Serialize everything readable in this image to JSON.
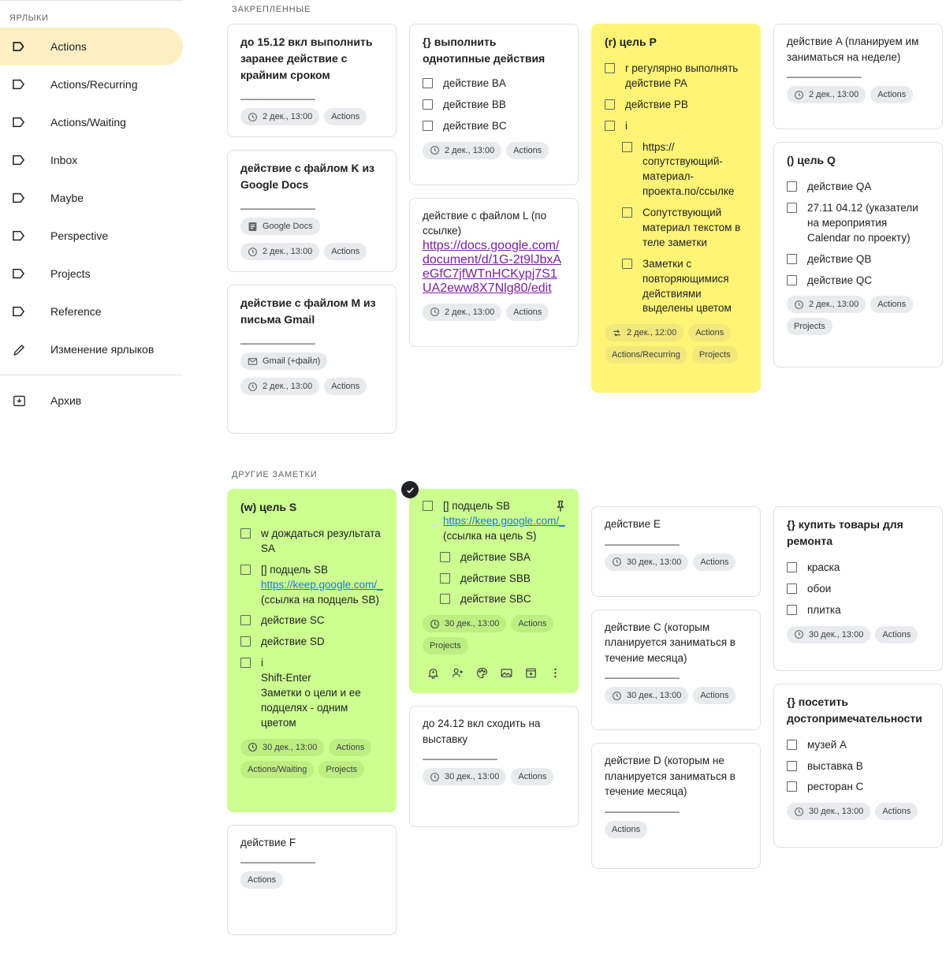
{
  "sidebar": {
    "header": "ЯРЛЫКИ",
    "items": [
      {
        "label": "Actions",
        "icon": "label-icon",
        "active": true
      },
      {
        "label": "Actions/Recurring",
        "icon": "label-icon",
        "active": false
      },
      {
        "label": "Actions/Waiting",
        "icon": "label-icon",
        "active": false
      },
      {
        "label": "Inbox",
        "icon": "label-icon",
        "active": false
      },
      {
        "label": "Maybe",
        "icon": "label-icon",
        "active": false
      },
      {
        "label": "Perspective",
        "icon": "label-icon",
        "active": false
      },
      {
        "label": "Projects",
        "icon": "label-icon",
        "active": false
      },
      {
        "label": "Reference",
        "icon": "label-icon",
        "active": false
      },
      {
        "label": "Изменение ярлыков",
        "icon": "pencil-icon",
        "active": false
      }
    ],
    "archive": {
      "label": "Архив",
      "icon": "archive-icon"
    }
  },
  "colors": {
    "yellow_note": "#fff475",
    "green_note": "#ccff90",
    "active_nav": "#feefc3",
    "chip_bg": "#e8eaed",
    "link_purple": "#7b1fa2",
    "link_blue": "#1a73e8"
  },
  "sections": {
    "pinned_title": "ЗАКРЕПЛЕННЫЕ",
    "other_title": "ДРУГИЕ ЗАМЕТКИ"
  },
  "notes": {
    "n1": {
      "title": "до 15.12 вкл выполнить заранее действие с крайним сроком",
      "dash": "______________",
      "chips": [
        {
          "label": "2 дек., 13:00",
          "icon": "clock-icon"
        },
        {
          "label": "Actions",
          "icon": "none"
        }
      ]
    },
    "n2": {
      "title": "действие с файлом K из Google Docs",
      "dash": "______________",
      "chips": [
        {
          "label": "Google Docs",
          "icon": "gdocs-icon"
        },
        {
          "label": "2 дек., 13:00",
          "icon": "clock-icon"
        },
        {
          "label": "Actions",
          "icon": "none"
        }
      ]
    },
    "n3": {
      "title": "действие с файлом M из письма Gmail",
      "dash": "______________",
      "chips": [
        {
          "label": "Gmail (+файл)",
          "icon": "gmail-icon"
        },
        {
          "label": "2 дек., 13:00",
          "icon": "clock-icon"
        },
        {
          "label": "Actions",
          "icon": "none"
        }
      ]
    },
    "n4": {
      "title": "{} выполнить однотипные действия",
      "items": [
        {
          "text": "действие BA",
          "indent": false
        },
        {
          "text": "действие BB",
          "indent": false
        },
        {
          "text": "действие BC",
          "indent": false
        }
      ],
      "chips": [
        {
          "label": "2 дек., 13:00",
          "icon": "clock-icon"
        },
        {
          "label": "Actions",
          "icon": "none"
        }
      ]
    },
    "n5": {
      "title": "действие с файлом L (по ссылке)",
      "link": "https://docs.google.com/document/d/1G-2t9lJbxAeGfC7jfWTnHCKypj7S1UA2eww8X7Nlg80/edit",
      "chips": [
        {
          "label": "2 дек., 13:00",
          "icon": "clock-icon"
        },
        {
          "label": "Actions",
          "icon": "none"
        }
      ]
    },
    "n6": {
      "title": "(r) цель P",
      "items": [
        {
          "text": "r регулярно выполнять действие PA",
          "indent": false
        },
        {
          "text": "действие PB",
          "indent": false
        },
        {
          "text": "i",
          "indent": false
        },
        {
          "text": "https://сопутствующий-материал-проекта.по/ссылке",
          "indent": true
        },
        {
          "text": "Сопутствующий материал текстом в теле заметки",
          "indent": true
        },
        {
          "text": "Заметки с повторяющимися действиями выделены цветом",
          "indent": true
        }
      ],
      "chips": [
        {
          "label": "2 дек., 12:00",
          "icon": "repeat-icon"
        },
        {
          "label": "Actions",
          "icon": "none"
        },
        {
          "label": "Actions/Recurring",
          "icon": "none"
        },
        {
          "label": "Projects",
          "icon": "none"
        }
      ]
    },
    "n7": {
      "title": "действие A (планируем им заниматься на неделе)",
      "dash": "______________",
      "chips": [
        {
          "label": "2 дек., 13:00",
          "icon": "clock-icon"
        },
        {
          "label": "Actions",
          "icon": "none"
        }
      ]
    },
    "n8": {
      "title": "() цель Q",
      "items": [
        {
          "text": "действие QA",
          "indent": false
        },
        {
          "text": "27.11 04.12 (указатели на мероприятия Calendar по проекту)",
          "indent": false
        },
        {
          "text": "действие QB",
          "indent": false
        },
        {
          "text": "действие QC",
          "indent": false
        }
      ],
      "chips": [
        {
          "label": "2 дек., 13:00",
          "icon": "clock-icon"
        },
        {
          "label": "Actions",
          "icon": "none"
        },
        {
          "label": "Projects",
          "icon": "none"
        }
      ]
    },
    "n9": {
      "title": "(w) цель S",
      "items": [
        {
          "text": "w дождаться результата SA",
          "indent": false
        },
        {
          "text": "[] подцель SB",
          "indent": false,
          "link": "https://keep.google.com/_",
          "after": "(ссылка на подцель SB)"
        },
        {
          "text": "действие SC",
          "indent": false
        },
        {
          "text": "действие SD",
          "indent": false
        },
        {
          "text": "i",
          "indent": false,
          "extra": "Shift-Enter\nЗаметки о цели и ее подцелях - одним цветом"
        }
      ],
      "chips": [
        {
          "label": "30 дек., 13:00",
          "icon": "clock-icon"
        },
        {
          "label": "Actions",
          "icon": "none"
        },
        {
          "label": "Actions/Waiting",
          "icon": "none"
        },
        {
          "label": "Projects",
          "icon": "none"
        }
      ]
    },
    "n10": {
      "title": "действие F",
      "dash": "______________",
      "chips": [
        {
          "label": "Actions",
          "icon": "none"
        }
      ]
    },
    "n11": {
      "first_item": "[] подцель SB",
      "link": "https://keep.google.com/_",
      "after_link": " (ссылка на цель S)",
      "items": [
        {
          "text": "действие SBA",
          "indent": true
        },
        {
          "text": "действие SBB",
          "indent": true
        },
        {
          "text": "действие SBC",
          "indent": true
        }
      ],
      "chips": [
        {
          "label": "30 дек., 13:00",
          "icon": "clock-icon"
        },
        {
          "label": "Actions",
          "icon": "none"
        },
        {
          "label": "Projects",
          "icon": "none"
        }
      ],
      "toolbar": [
        "reminder-bell-icon",
        "collaborator-add-icon",
        "palette-icon",
        "image-icon",
        "archive-icon",
        "more-options-icon"
      ],
      "pin": "pin-icon",
      "selected": true
    },
    "n12": {
      "title": "до 24.12 вкл сходить на выставку",
      "dash": "______________",
      "chips": [
        {
          "label": "30 дек., 13:00",
          "icon": "clock-icon"
        },
        {
          "label": "Actions",
          "icon": "none"
        }
      ]
    },
    "n13": {
      "title": "действие E",
      "dash": "______________",
      "chips": [
        {
          "label": "30 дек., 13:00",
          "icon": "clock-icon"
        },
        {
          "label": "Actions",
          "icon": "none"
        }
      ]
    },
    "n14": {
      "title": "действие C (которым планируется заниматься в течение месяца)",
      "dash": "______________",
      "chips": [
        {
          "label": "30 дек., 13:00",
          "icon": "clock-icon"
        },
        {
          "label": "Actions",
          "icon": "none"
        }
      ]
    },
    "n15": {
      "title": "действие D (которым не планируется заниматься в течение месяца)",
      "dash": "______________",
      "chips": [
        {
          "label": "Actions",
          "icon": "none"
        }
      ]
    },
    "n16": {
      "title": "{} купить товары для ремонта",
      "items": [
        {
          "text": "краска",
          "indent": false
        },
        {
          "text": "обои",
          "indent": false
        },
        {
          "text": "плитка",
          "indent": false
        }
      ],
      "chips": [
        {
          "label": "30 дек., 13:00",
          "icon": "clock-icon"
        },
        {
          "label": "Actions",
          "icon": "none"
        }
      ]
    },
    "n17": {
      "title": "{} посетить достопримечательности",
      "items": [
        {
          "text": "музей A",
          "indent": false
        },
        {
          "text": "выставка B",
          "indent": false
        },
        {
          "text": "ресторан C",
          "indent": false
        }
      ],
      "chips": [
        {
          "label": "30 дек., 13:00",
          "icon": "clock-icon"
        },
        {
          "label": "Actions",
          "icon": "none"
        }
      ]
    }
  }
}
